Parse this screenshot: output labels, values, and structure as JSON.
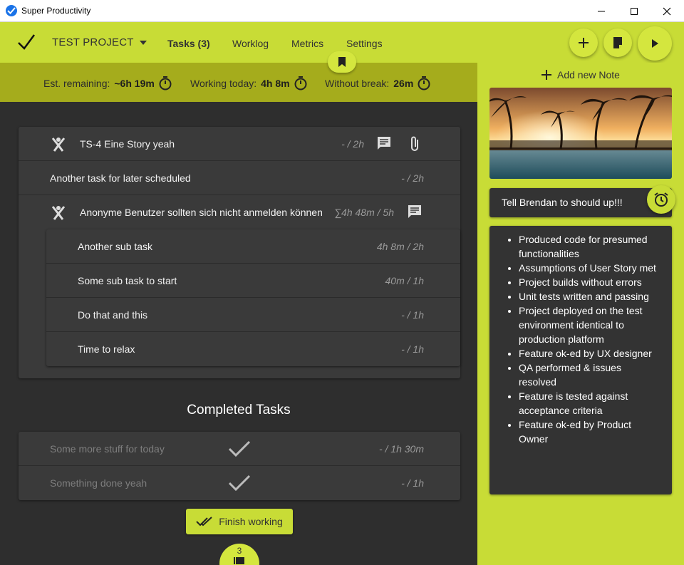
{
  "window": {
    "title": "Super Productivity"
  },
  "header": {
    "project": "TEST PROJECT",
    "nav": [
      "Tasks (3)",
      "Worklog",
      "Metrics",
      "Settings"
    ]
  },
  "stats": {
    "est_label": "Est. remaining:",
    "est_value": "~6h 19m",
    "today_label": "Working today:",
    "today_value": "4h 8m",
    "break_label": "Without break:",
    "break_value": "26m"
  },
  "tasks": [
    {
      "title": "TS-4 Eine Story yeah",
      "time": "- / 2h"
    },
    {
      "title": "Another task for later scheduled",
      "time": "- / 2h"
    },
    {
      "title": "Anonyme Benutzer sollten sich nicht anmelden können",
      "time": "∑4h 48m / 5h"
    }
  ],
  "subtasks": [
    {
      "title": "Another sub task",
      "time": "4h 8m / 2h"
    },
    {
      "title": "Some sub task to start",
      "time": "40m / 1h"
    },
    {
      "title": "Do that and this",
      "time": "- / 1h"
    },
    {
      "title": "Time to relax",
      "time": "- / 1h"
    }
  ],
  "completed": {
    "title": "Completed Tasks",
    "items": [
      {
        "title": "Some more stuff for today",
        "time": "- / 1h 30m"
      },
      {
        "title": "Something done yeah",
        "time": "- / 1h"
      }
    ]
  },
  "finish_label": "Finish working",
  "bottom_count": "3",
  "notes": {
    "add_label": "Add new Note",
    "reminder_text": "Tell Brendan to should up!!!",
    "checklist": [
      "Produced code for presumed functionalities",
      "Assumptions of User Story met",
      "Project builds without errors",
      "Unit tests written and passing",
      "Project deployed on the test environment identical to production platform",
      "Feature ok-ed by UX designer",
      "QA performed & issues resolved",
      "Feature is tested against acceptance criteria",
      "Feature ok-ed by Product Owner"
    ]
  },
  "colors": {
    "accent": "#c8dc36",
    "stats_bar": "#a5ac1c",
    "background": "#2e2e2e",
    "card": "#3a3a3a"
  }
}
